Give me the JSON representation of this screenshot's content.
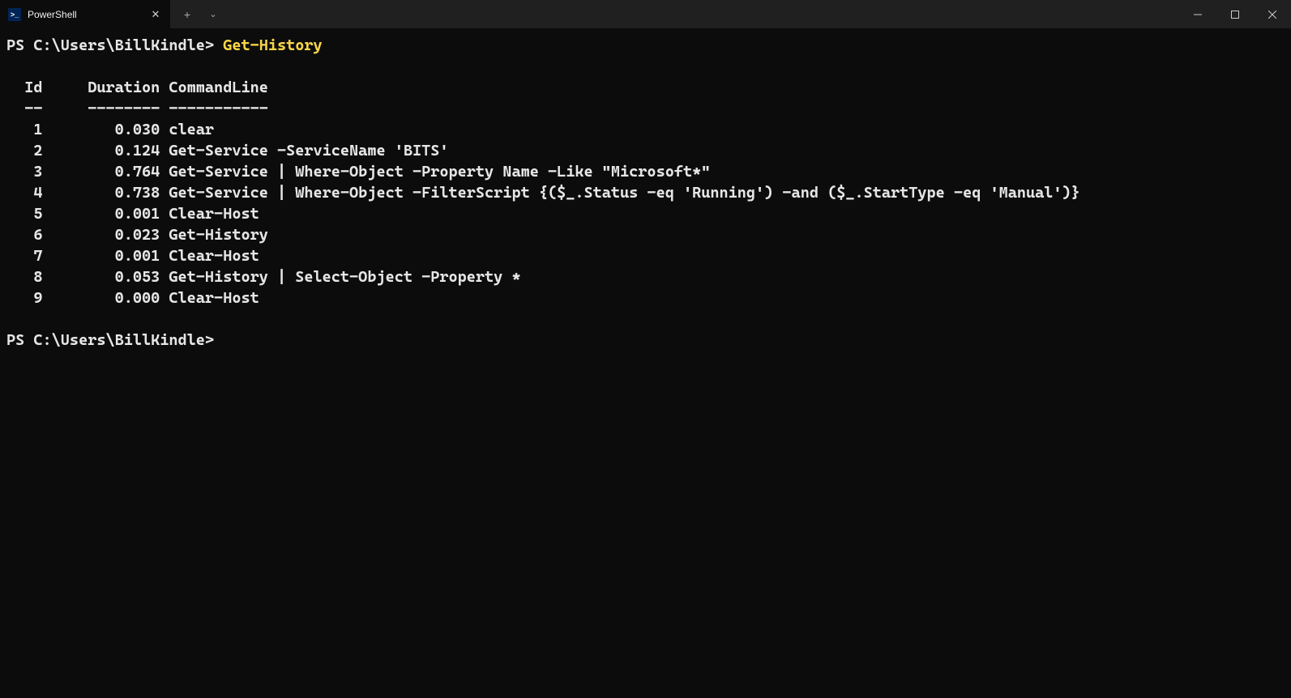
{
  "titlebar": {
    "tab_title": "PowerShell",
    "tab_icon_text": ">_"
  },
  "terminal": {
    "prompt1_prefix": "PS C:\\Users\\BillKindle> ",
    "command1": "Get-History",
    "headers": {
      "id": "Id",
      "duration": "Duration",
      "commandline": "CommandLine"
    },
    "separators": {
      "id": "--",
      "duration": "--------",
      "commandline": "-----------"
    },
    "rows": [
      {
        "id": "1",
        "duration": "0.030",
        "cmd": "clear"
      },
      {
        "id": "2",
        "duration": "0.124",
        "cmd": "Get-Service -ServiceName 'BITS'"
      },
      {
        "id": "3",
        "duration": "0.764",
        "cmd": "Get-Service | Where-Object -Property Name -Like \"Microsoft*\""
      },
      {
        "id": "4",
        "duration": "0.738",
        "cmd": "Get-Service | Where-Object -FilterScript {($_.Status -eq 'Running') -and ($_.StartType -eq 'Manual')}"
      },
      {
        "id": "5",
        "duration": "0.001",
        "cmd": "Clear-Host"
      },
      {
        "id": "6",
        "duration": "0.023",
        "cmd": "Get-History"
      },
      {
        "id": "7",
        "duration": "0.001",
        "cmd": "Clear-Host"
      },
      {
        "id": "8",
        "duration": "0.053",
        "cmd": "Get-History | Select-Object -Property *"
      },
      {
        "id": "9",
        "duration": "0.000",
        "cmd": "Clear-Host"
      }
    ],
    "prompt2": "PS C:\\Users\\BillKindle>"
  }
}
